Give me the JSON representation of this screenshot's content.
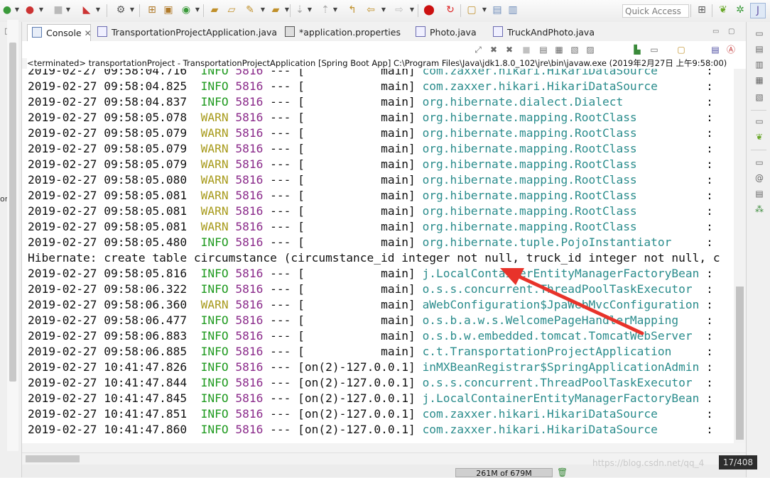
{
  "colors": {
    "info": "#1f9a1f",
    "warn": "#a79a1a",
    "pid": "#8a2a8a",
    "logger": "#2a8c8c",
    "arrow": "#e8332a"
  },
  "toolbar": {
    "icons": [
      "debug-icon",
      "run-icon",
      "stop-icon",
      "external-tools-icon",
      "build-icon",
      "new-java-package-icon",
      "new-class-icon",
      "new-web-icon",
      "open-folder-icon",
      "open-type-icon",
      "search-icon",
      "next-annotation-icon",
      "prev-annotation-icon",
      "back-icon",
      "forward-icon",
      "ant-icon",
      "refresh-icon",
      "new-window-icon",
      "save-icon",
      "save-all-icon"
    ],
    "quick_access_placeholder": "Quick Access",
    "right_icons": [
      "open-perspective-icon",
      "spring-perspective-icon",
      "debug-perspective-icon",
      "java-perspective-icon"
    ]
  },
  "left_strip": {
    "label": "or"
  },
  "tabs": [
    {
      "label": "Console",
      "icon": "console-icon",
      "active": true,
      "closable": true
    },
    {
      "label": "TransportationProjectApplication.java",
      "icon": "java-file-icon"
    },
    {
      "label": "*application.properties",
      "icon": "properties-file-icon"
    },
    {
      "label": "Photo.java",
      "icon": "java-file-icon"
    },
    {
      "label": "TruckAndPhoto.java",
      "icon": "java-file-icon"
    }
  ],
  "console_toolbar_icons": [
    "pin-icon",
    "remove-launch-icon",
    "remove-all-icon",
    "terminate-icon",
    "scroll-lock-icon",
    "word-wrap-icon",
    "show-stdout-icon",
    "show-stderr-icon",
    "open-console-icon",
    "display-selected-icon",
    "new-console-icon",
    "clear-console-icon",
    "spring-icon"
  ],
  "status_line": "<terminated> transportationProject - TransportationProjectApplication [Spring Boot App] C:\\Program Files\\Java\\jdk1.8.0_102\\jre\\bin\\javaw.exe (2019年2月27日 上午9:58:00)",
  "log": [
    {
      "ts": "2019-02-27 09:58:04.716",
      "level": "INFO",
      "pid": "5816",
      "sep": "---",
      "thread": "[           main]",
      "logger": "com.zaxxer.hikari.HikariDataSource",
      "tail": ":"
    },
    {
      "ts": "2019-02-27 09:58:04.825",
      "level": "INFO",
      "pid": "5816",
      "sep": "---",
      "thread": "[           main]",
      "logger": "com.zaxxer.hikari.HikariDataSource",
      "tail": ":"
    },
    {
      "ts": "2019-02-27 09:58:04.837",
      "level": "INFO",
      "pid": "5816",
      "sep": "---",
      "thread": "[           main]",
      "logger": "org.hibernate.dialect.Dialect",
      "tail": ":"
    },
    {
      "ts": "2019-02-27 09:58:05.078",
      "level": "WARN",
      "pid": "5816",
      "sep": "---",
      "thread": "[           main]",
      "logger": "org.hibernate.mapping.RootClass",
      "tail": ":"
    },
    {
      "ts": "2019-02-27 09:58:05.079",
      "level": "WARN",
      "pid": "5816",
      "sep": "---",
      "thread": "[           main]",
      "logger": "org.hibernate.mapping.RootClass",
      "tail": ":"
    },
    {
      "ts": "2019-02-27 09:58:05.079",
      "level": "WARN",
      "pid": "5816",
      "sep": "---",
      "thread": "[           main]",
      "logger": "org.hibernate.mapping.RootClass",
      "tail": ":"
    },
    {
      "ts": "2019-02-27 09:58:05.079",
      "level": "WARN",
      "pid": "5816",
      "sep": "---",
      "thread": "[           main]",
      "logger": "org.hibernate.mapping.RootClass",
      "tail": ":"
    },
    {
      "ts": "2019-02-27 09:58:05.080",
      "level": "WARN",
      "pid": "5816",
      "sep": "---",
      "thread": "[           main]",
      "logger": "org.hibernate.mapping.RootClass",
      "tail": ":"
    },
    {
      "ts": "2019-02-27 09:58:05.081",
      "level": "WARN",
      "pid": "5816",
      "sep": "---",
      "thread": "[           main]",
      "logger": "org.hibernate.mapping.RootClass",
      "tail": ":"
    },
    {
      "ts": "2019-02-27 09:58:05.081",
      "level": "WARN",
      "pid": "5816",
      "sep": "---",
      "thread": "[           main]",
      "logger": "org.hibernate.mapping.RootClass",
      "tail": ":"
    },
    {
      "ts": "2019-02-27 09:58:05.081",
      "level": "WARN",
      "pid": "5816",
      "sep": "---",
      "thread": "[           main]",
      "logger": "org.hibernate.mapping.RootClass",
      "tail": ":"
    },
    {
      "ts": "2019-02-27 09:58:05.480",
      "level": "INFO",
      "pid": "5816",
      "sep": "---",
      "thread": "[           main]",
      "logger": "org.hibernate.tuple.PojoInstantiator",
      "tail": ":"
    },
    {
      "plain": "Hibernate: create table circumstance (circumstance_id integer not null, truck_id integer not null, c"
    },
    {
      "ts": "2019-02-27 09:58:05.816",
      "level": "INFO",
      "pid": "5816",
      "sep": "---",
      "thread": "[           main]",
      "logger": "j.LocalContainerEntityManagerFactoryBean",
      "tail": ":"
    },
    {
      "ts": "2019-02-27 09:58:06.322",
      "level": "INFO",
      "pid": "5816",
      "sep": "---",
      "thread": "[           main]",
      "logger": "o.s.s.concurrent.ThreadPoolTaskExecutor",
      "tail": ":"
    },
    {
      "ts": "2019-02-27 09:58:06.360",
      "level": "WARN",
      "pid": "5816",
      "sep": "---",
      "thread": "[           main]",
      "logger": "aWebConfiguration$JpaWebMvcConfiguration",
      "tail": ":"
    },
    {
      "ts": "2019-02-27 09:58:06.477",
      "level": "INFO",
      "pid": "5816",
      "sep": "---",
      "thread": "[           main]",
      "logger": "o.s.b.a.w.s.WelcomePageHandlerMapping",
      "tail": ":"
    },
    {
      "ts": "2019-02-27 09:58:06.883",
      "level": "INFO",
      "pid": "5816",
      "sep": "---",
      "thread": "[           main]",
      "logger": "o.s.b.w.embedded.tomcat.TomcatWebServer",
      "tail": ":"
    },
    {
      "ts": "2019-02-27 09:58:06.885",
      "level": "INFO",
      "pid": "5816",
      "sep": "---",
      "thread": "[           main]",
      "logger": "c.t.TransportationProjectApplication",
      "tail": ":"
    },
    {
      "ts": "2019-02-27 10:41:47.826",
      "level": "INFO",
      "pid": "5816",
      "sep": "---",
      "thread": "[on(2)-127.0.0.1]",
      "logger": "inMXBeanRegistrar$SpringApplicationAdmin",
      "tail": ":"
    },
    {
      "ts": "2019-02-27 10:41:47.844",
      "level": "INFO",
      "pid": "5816",
      "sep": "---",
      "thread": "[on(2)-127.0.0.1]",
      "logger": "o.s.s.concurrent.ThreadPoolTaskExecutor",
      "tail": ":"
    },
    {
      "ts": "2019-02-27 10:41:47.845",
      "level": "INFO",
      "pid": "5816",
      "sep": "---",
      "thread": "[on(2)-127.0.0.1]",
      "logger": "j.LocalContainerEntityManagerFactoryBean",
      "tail": ":"
    },
    {
      "ts": "2019-02-27 10:41:47.851",
      "level": "INFO",
      "pid": "5816",
      "sep": "---",
      "thread": "[on(2)-127.0.0.1]",
      "logger": "com.zaxxer.hikari.HikariDataSource",
      "tail": ":"
    },
    {
      "ts": "2019-02-27 10:41:47.860",
      "level": "INFO",
      "pid": "5816",
      "sep": "---",
      "thread": "[on(2)-127.0.0.1]",
      "logger": "com.zaxxer.hikari.HikariDataSource",
      "tail": ":"
    }
  ],
  "statusbar": {
    "heap": "261M of 679M",
    "position": "17/408"
  },
  "watermark": "https://blog.csdn.net/qq_4"
}
